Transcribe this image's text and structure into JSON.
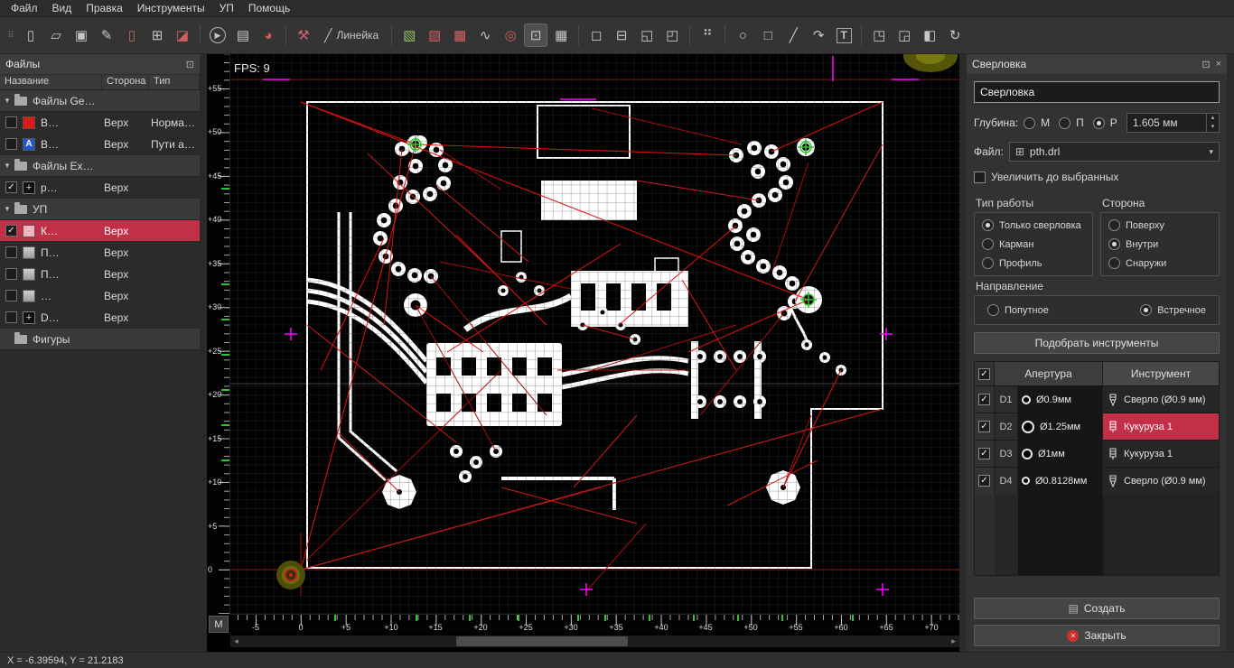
{
  "colors": {
    "accent_red": "#c22f47",
    "magenta": "#ff00ff",
    "ratsnest_red": "#e21212",
    "mark_green": "#30c030"
  },
  "menubar": {
    "items": [
      "Файл",
      "Вид",
      "Правка",
      "Инструменты",
      "УП",
      "Помощь"
    ]
  },
  "toolbar": {
    "ruler_label": "Линейка",
    "icons": [
      {
        "name": "grip",
        "glyph": "⠿"
      },
      {
        "name": "new-file",
        "glyph": "▯"
      },
      {
        "name": "open-file",
        "glyph": "▱"
      },
      {
        "name": "save-file",
        "glyph": "▣"
      },
      {
        "name": "edit-file",
        "glyph": "✎"
      },
      {
        "name": "import-file",
        "glyph": "▯"
      },
      {
        "name": "export-file",
        "glyph": "⊞"
      },
      {
        "name": "merge-files",
        "glyph": "◪"
      },
      {
        "name": "run",
        "glyph": "▶"
      },
      {
        "name": "report",
        "glyph": "▤"
      },
      {
        "name": "statistics",
        "glyph": "◕"
      },
      {
        "name": "machine",
        "glyph": "⚒"
      },
      {
        "name": "ruler",
        "glyph": "╱"
      },
      {
        "name": "film-top",
        "glyph": "▧"
      },
      {
        "name": "film-bottom",
        "glyph": "▨"
      },
      {
        "name": "film-stack",
        "glyph": "▩"
      },
      {
        "name": "curve",
        "glyph": "∿"
      },
      {
        "name": "drill-holes",
        "glyph": "◎"
      },
      {
        "name": "crosshair-frame",
        "glyph": "⊡"
      },
      {
        "name": "grid",
        "glyph": "▦"
      },
      {
        "name": "select-rect",
        "glyph": "◻"
      },
      {
        "name": "select-subtract",
        "glyph": "⊟"
      },
      {
        "name": "zoom-selection",
        "glyph": "◱"
      },
      {
        "name": "zoom-all",
        "glyph": "◰"
      },
      {
        "name": "pad-matrix",
        "glyph": "⠛"
      },
      {
        "name": "circle-tool",
        "glyph": "○"
      },
      {
        "name": "rect-tool",
        "glyph": "□"
      },
      {
        "name": "line-tool",
        "glyph": "╱"
      },
      {
        "name": "arc-tool",
        "glyph": "↷"
      },
      {
        "name": "text-tool",
        "glyph": "T"
      },
      {
        "name": "attach",
        "glyph": "◳"
      },
      {
        "name": "detach",
        "glyph": "◲"
      },
      {
        "name": "combine",
        "glyph": "◧"
      },
      {
        "name": "refresh",
        "glyph": "↻"
      }
    ]
  },
  "icons": {
    "float": "⊡",
    "close": "×",
    "arrow_down": "▾",
    "combo_arrow": "▾",
    "spin_up": "▴",
    "spin_down": "▾",
    "scroll_left": "◂",
    "scroll_right": "▸",
    "create": "▤",
    "file_combo": "⊞"
  },
  "files_panel": {
    "title": "Файлы",
    "columns": [
      "Название",
      "Сторона",
      "Тип"
    ],
    "rows": [
      {
        "kind": "group",
        "label": "Файлы Ge…"
      },
      {
        "kind": "item",
        "name": "В…",
        "side": "Верх",
        "type": "Норма…"
      },
      {
        "kind": "item",
        "name": "В…",
        "side": "Верх",
        "type": "Пути а…"
      },
      {
        "kind": "group",
        "label": "Файлы Ex…"
      },
      {
        "kind": "item",
        "name": "р…",
        "side": "Верх",
        "type": ""
      },
      {
        "kind": "group",
        "label": "УП"
      },
      {
        "kind": "item",
        "name": "К…",
        "side": "Верх",
        "type": ""
      },
      {
        "kind": "item",
        "name": "П…",
        "side": "Верх",
        "type": ""
      },
      {
        "kind": "item",
        "name": "П…",
        "side": "Верх",
        "type": ""
      },
      {
        "kind": "item",
        "name": "…",
        "side": "Верх",
        "type": ""
      },
      {
        "kind": "item",
        "name": "D…",
        "side": "Верх",
        "type": ""
      },
      {
        "kind": "group",
        "label": "Фигуры"
      }
    ]
  },
  "canvas": {
    "fps": "FPS: 9",
    "unit_button": "М",
    "v_ruler": [
      "+55",
      "+50",
      "+45",
      "+40",
      "+35",
      "+30",
      "+25",
      "+20",
      "+15",
      "+10",
      "+5",
      "0"
    ],
    "h_ruler": [
      "-5",
      "0",
      "+5",
      "+10",
      "+15",
      "+20",
      "+25",
      "+30",
      "+35",
      "+40",
      "+45",
      "+50",
      "+55",
      "+60",
      "+65",
      "+70"
    ]
  },
  "drill_panel": {
    "title": "Сверловка",
    "name_value": "Сверловка",
    "depth_label": "Глубина:",
    "depth_options": [
      "М",
      "П",
      "Р"
    ],
    "depth_selected": "Р",
    "depth_value": "1.605 мм",
    "file_label": "Файл:",
    "file_value": "pth.drl",
    "zoom_checkbox_label": "Увеличить до выбранных",
    "work_type_label": "Тип работы",
    "work_type_options": [
      "Только сверловка",
      "Карман",
      "Профиль"
    ],
    "work_type_selected": "Только сверловка",
    "side_label": "Сторона",
    "side_options": [
      "Поверху",
      "Внутри",
      "Снаружи"
    ],
    "side_selected": "Внутри",
    "direction_label": "Направление",
    "direction_options": [
      "Попутное",
      "Встречное"
    ],
    "direction_selected": "Встречное",
    "pick_tools_button": "Подобрать инструменты",
    "table": {
      "columns": [
        "Апертура",
        "Инструмент"
      ],
      "rows": [
        {
          "id": "D1",
          "aperture": "Ø0.9мм",
          "tool": "Сверло (Ø0.9 мм)",
          "checked": true,
          "selected": false
        },
        {
          "id": "D2",
          "aperture": "Ø1.25мм",
          "tool": "Кукуруза 1",
          "checked": true,
          "selected": true
        },
        {
          "id": "D3",
          "aperture": "Ø1мм",
          "tool": "Кукуруза 1",
          "checked": true,
          "selected": false
        },
        {
          "id": "D4",
          "aperture": "Ø0.8128мм",
          "tool": "Сверло (Ø0.9 мм)",
          "checked": true,
          "selected": false
        }
      ]
    },
    "create_button": "Создать",
    "close_button": "Закрыть"
  },
  "statusbar": {
    "coords": "X = -6.39594, Y = 21.2183"
  }
}
